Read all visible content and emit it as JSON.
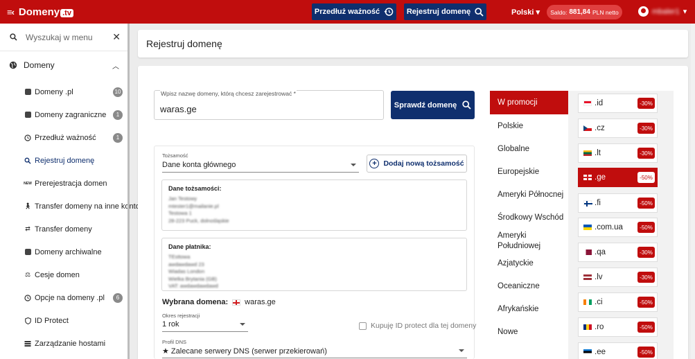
{
  "header": {
    "logo_text": "Domeny",
    "logo_suffix": ".tv",
    "renew_label": "Przedłuż ważność",
    "register_label": "Rejestruj domenę",
    "language": "Polski",
    "saldo_prefix": "Saldo:",
    "saldo_amount": "881,84",
    "saldo_suffix": "PLN netto",
    "username": "mbaler1"
  },
  "sidebar": {
    "search_placeholder": "Wyszukaj w menu",
    "group_label": "Domeny",
    "items": [
      {
        "label": "Domeny .pl",
        "count": "10",
        "icon": "pl-domains-icon"
      },
      {
        "label": "Domeny zagraniczne",
        "count": "1",
        "icon": "foreign-domains-icon"
      },
      {
        "label": "Przedłuż ważność",
        "count": "1",
        "icon": "clock-icon"
      },
      {
        "label": "Rejestruj domenę",
        "count": "",
        "icon": "search-icon"
      },
      {
        "label": "Prerejestracja domen",
        "count": "",
        "icon": "new-icon"
      },
      {
        "label": "Transfer domeny na inne konto",
        "count": "",
        "icon": "transfer-person-icon"
      },
      {
        "label": "Transfer domeny",
        "count": "",
        "icon": "arrows-icon"
      },
      {
        "label": "Domeny archiwalne",
        "count": "",
        "icon": "archive-icon"
      },
      {
        "label": "Cesje domen",
        "count": "",
        "icon": "assignment-icon"
      },
      {
        "label": "Opcje na domeny .pl",
        "count": "6",
        "icon": "clock-options-icon"
      },
      {
        "label": "ID Protect",
        "count": "",
        "icon": "shield-icon"
      },
      {
        "label": "Zarządzanie hostami",
        "count": "",
        "icon": "hosts-icon"
      }
    ]
  },
  "page": {
    "title": "Rejestruj domenę",
    "domain_field_label": "Wpisz nazwę domeny, którą chcesz zarejestrować *",
    "domain_value": "waras.ge",
    "check_button": "Sprawdź domenę",
    "identity_label": "Tożsamość",
    "identity_value": "Dane konta głównego",
    "add_identity_button": "Dodaj nową tożsamość",
    "identity_data_title": "Dane tożsamości:",
    "identity_lines": [
      "Jan Testowy",
      "mtester1@mailanie.pl",
      "Testowa 1",
      "28-223 Puck, dolnośląskie"
    ],
    "payer_data_title": "Dane płatnika:",
    "payer_lines": [
      "TEsttowa",
      "awdawdawd 23",
      "Wiadas London",
      "Wielka Brytania (GB)",
      "VAT: awdawdawdawd"
    ],
    "chosen_domain_label": "Wybrana domena:",
    "chosen_domain_value": "waras.ge",
    "period_label": "Okres rejestracji",
    "period_value": "1 rok",
    "protect_label": "Kupuję ID protect dla tej domeny",
    "dns_label": "Profil DNS",
    "dns_value": "★ Zalecane serwery DNS (serwer przekierowań)"
  },
  "categories": [
    "W promocji",
    "Polskie",
    "Globalne",
    "Europejskie",
    "Ameryki Północnej",
    "Środkowy Wschód",
    "Ameryki Południowej",
    "Azjatyckie",
    "Oceaniczne",
    "Afrykańskie",
    "Nowe"
  ],
  "promotions": [
    {
      "tld": ".id",
      "badge": "-30%",
      "flag": "indonesia-flag-icon"
    },
    {
      "tld": ".cz",
      "badge": "-30%",
      "flag": "czech-flag-icon"
    },
    {
      "tld": ".lt",
      "badge": "-30%",
      "flag": "lithuania-flag-icon"
    },
    {
      "tld": ".ge",
      "badge": "-50%",
      "flag": "georgia-flag-icon"
    },
    {
      "tld": ".fi",
      "badge": "-50%",
      "flag": "finland-flag-icon"
    },
    {
      "tld": ".com.ua",
      "badge": "-50%",
      "flag": "ukraine-flag-icon"
    },
    {
      "tld": ".qa",
      "badge": "-30%",
      "flag": "qatar-flag-icon"
    },
    {
      "tld": ".lv",
      "badge": "-30%",
      "flag": "latvia-flag-icon"
    },
    {
      "tld": ".ci",
      "badge": "-50%",
      "flag": "ivory-coast-flag-icon"
    },
    {
      "tld": ".ro",
      "badge": "-50%",
      "flag": "romania-flag-icon"
    },
    {
      "tld": ".ee",
      "badge": "-50%",
      "flag": "estonia-flag-icon"
    }
  ],
  "colors": {
    "brand_red": "#c00d0d",
    "navy": "#0f2f6e"
  }
}
